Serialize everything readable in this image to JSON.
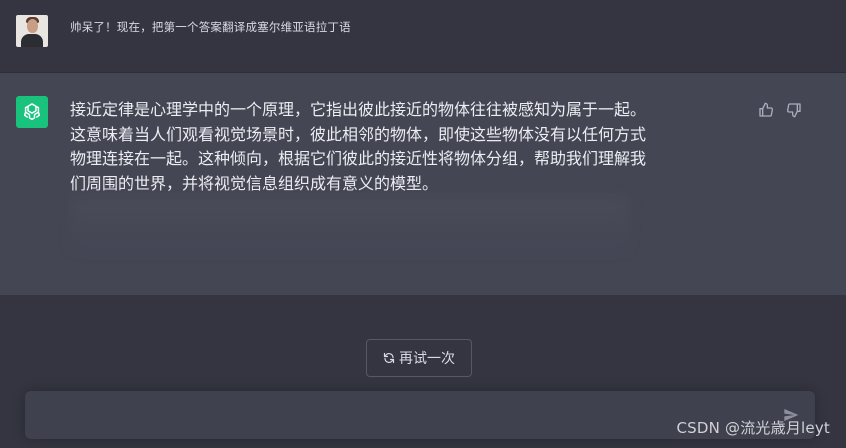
{
  "user_message": {
    "text": "帅呆了！现在，把第一个答案翻译成塞尔维亚语拉丁语"
  },
  "assistant_message": {
    "lines": [
      "接近定律是心理学中的一个原理，它指出彼此接近的物体往往被感知为属于一起。",
      "这意味着当人们观看视觉场景时，彼此相邻的物体，即使这些物体没有以任何方式",
      "物理连接在一起。这种倾向，根据它们彼此的接近性将物体分组，帮助我们理解我",
      "们周围的世界，并将视觉信息组织成有意义的模型。"
    ],
    "icons": {
      "avatar": "openai-logo-icon",
      "like": "thumbs-up-icon",
      "dislike": "thumbs-down-icon"
    }
  },
  "regenerate_button": {
    "label": "再试一次",
    "icon": "refresh-icon"
  },
  "input": {
    "value": "",
    "send_icon": "send-icon"
  },
  "watermark": {
    "text": "CSDN @流光歳月leyt"
  },
  "colors": {
    "background": "#343541",
    "assistant_bg": "#444654",
    "accent": "#19c37d"
  }
}
